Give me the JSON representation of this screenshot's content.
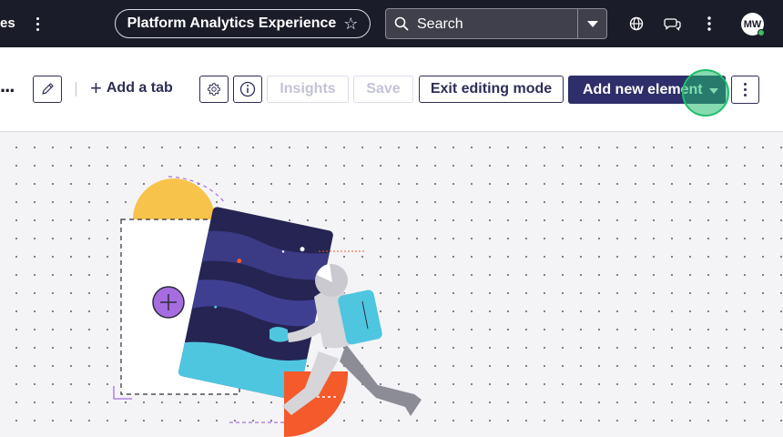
{
  "nav": {
    "left_truncated": "es",
    "app_title": "Platform Analytics Experience",
    "search": {
      "placeholder": "Search"
    },
    "avatar_initials": "MW",
    "icons": [
      "more-vertical-icon",
      "star-icon",
      "search-icon",
      "chevron-down-icon",
      "globe-icon",
      "chat-icon",
      "more-vertical-icon"
    ]
  },
  "toolbar": {
    "truncated_text": "...",
    "add_tab_label": "Add a tab",
    "insights_label": "Insights",
    "save_label": "Save",
    "exit_label": "Exit editing mode",
    "add_element_label": "Add new element",
    "icons": [
      "pencil-icon",
      "plus-icon",
      "gear-icon",
      "info-icon",
      "caret-down-icon",
      "more-vertical-icon"
    ]
  },
  "colors": {
    "nav_bg": "#1b1c29",
    "primary": "#2e2e6b",
    "click_indicator": "#1fbf6a",
    "illustration_purple": "#a66de0",
    "illustration_cyan": "#4fc6e0",
    "illustration_orange": "#f45a2a",
    "illustration_yellow": "#f7c34a",
    "illustration_navy": "#252452"
  }
}
